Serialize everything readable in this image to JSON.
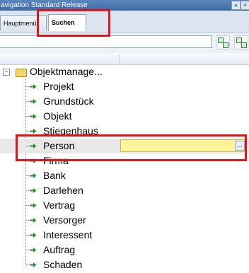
{
  "window": {
    "title": "avigation Standard Release"
  },
  "tabs": [
    {
      "label": "Hauptmenü"
    },
    {
      "label": "Suchen"
    }
  ],
  "tree": {
    "root_label": "Objektmanage...",
    "items": [
      {
        "label": "Projekt"
      },
      {
        "label": "Grundstück"
      },
      {
        "label": "Objekt"
      },
      {
        "label": "Stiegenhaus"
      },
      {
        "label": "Person"
      },
      {
        "label": "Firma"
      },
      {
        "label": "Bank"
      },
      {
        "label": "Darlehen"
      },
      {
        "label": "Vertrag"
      },
      {
        "label": "Versorger"
      },
      {
        "label": "Interessent"
      },
      {
        "label": "Auftrag"
      },
      {
        "label": "Schaden"
      }
    ]
  },
  "person_field": {
    "button_label": "..."
  },
  "colors": {
    "highlight": "#e0151b",
    "field": "#fdf39a",
    "arrow": "#2e8b2e"
  }
}
